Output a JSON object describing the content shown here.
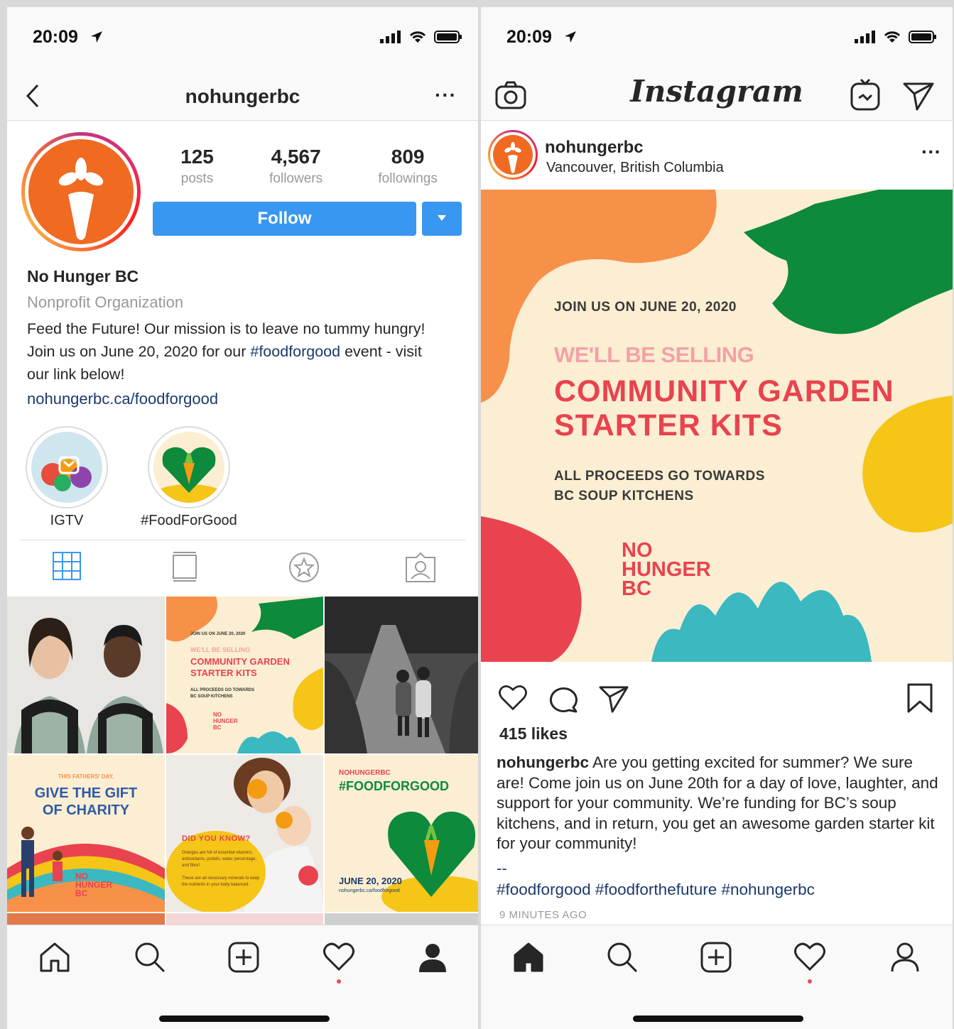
{
  "left": {
    "status": {
      "time": "20:09"
    },
    "header": {
      "title": "nohungerbc",
      "more": "···"
    },
    "profile": {
      "stats": [
        {
          "value": "125",
          "label": "posts"
        },
        {
          "value": "4,567",
          "label": "followers"
        },
        {
          "value": "809",
          "label": "followings"
        }
      ],
      "follow_label": "Follow",
      "name": "No Hunger BC",
      "category": "Nonprofit Organization",
      "bio_line_1": "Feed the Future! Our mission is to leave no tummy hungry!",
      "bio_line_2_a": "Join us on June 20, 2020 for our ",
      "bio_hashtag": "#foodforgood",
      "bio_line_2_b": " event - visit",
      "bio_line_3": "our link below!",
      "link": "nohungerbc.ca/foodforgood"
    },
    "highlights": [
      {
        "label": "IGTV"
      },
      {
        "label": "#FoodForGood"
      }
    ],
    "grid": {
      "tile2_line1": "JOIN US ON JUNE 20, 2020",
      "tile2_line2": "WE'LL BE SELLING",
      "tile2_line3": "COMMUNITY GARDEN",
      "tile2_line4": "STARTER KITS",
      "tile2_line5": "ALL PROCEEDS GO TOWARDS",
      "tile2_line6": "BC SOUP KITCHENS",
      "tile2_brand": "NO HUNGER BC",
      "tile4_kicker": "THIS FATHERS' DAY,",
      "tile4_title1": "GIVE THE GIFT",
      "tile4_title2": "OF CHARITY",
      "tile4_brand": "NO HUNGER BC",
      "tile5_title": "DID YOU KNOW?",
      "tile5_text1": "Oranges are full of essential vitamins, antioxidants, protein, water percentage, and fibre!",
      "tile5_text2": "These are all necessary minerals to keep the nutrients in your body balanced.",
      "tile6_kicker": "NOHUNGERBC",
      "tile6_title": "#FOODFORGOOD",
      "tile6_date": "JUNE 20, 2020",
      "tile6_url": "nohungerbc.ca/foodforgood"
    }
  },
  "right": {
    "status": {
      "time": "20:09"
    },
    "header": {
      "logo": "Instagram"
    },
    "post": {
      "username": "nohungerbc",
      "location": "Vancouver, British Columbia",
      "more": "···",
      "image": {
        "line1": "JOIN US ON JUNE 20, 2020",
        "line2": "WE'LL BE SELLING",
        "line3": "COMMUNITY GARDEN",
        "line4": "STARTER KITS",
        "line5": "ALL PROCEEDS GO TOWARDS",
        "line6": "BC SOUP KITCHENS",
        "brand1": "NO",
        "brand2": "HUNGER",
        "brand3": "BC"
      },
      "likes": "415 likes",
      "caption_user": "nohungerbc",
      "caption_text": " Are you getting excited for summer? We sure are! Come join us on June 20th for a day of love, laughter, and support for your community. We’re funding for BC’s soup kitchens, and in return, you get an awesome garden starter kit for your community!",
      "dashes": "--",
      "hashtags": "#foodforgood #foodforthefuture #nohungerbc",
      "time_ago": "9 MINUTES AGO"
    }
  },
  "colors": {
    "brand_orange": "#f06a22",
    "follow_blue": "#3897f0",
    "link_navy": "#1b3a6b",
    "poster_cream": "#fbeed2",
    "poster_red": "#e8434f",
    "poster_green": "#0d8a3c",
    "poster_yellow": "#f5c518",
    "poster_teal": "#3bb8c0"
  },
  "icons": [
    "location-arrow-icon",
    "signal-icon",
    "wifi-icon",
    "battery-icon",
    "back-chevron-icon",
    "grid-icon",
    "feed-icon",
    "star-icon",
    "tagged-icon",
    "home-icon",
    "search-icon",
    "add-icon",
    "heart-icon",
    "profile-icon",
    "camera-icon",
    "igtv-icon",
    "direct-icon",
    "comment-icon",
    "share-icon",
    "bookmark-icon"
  ]
}
